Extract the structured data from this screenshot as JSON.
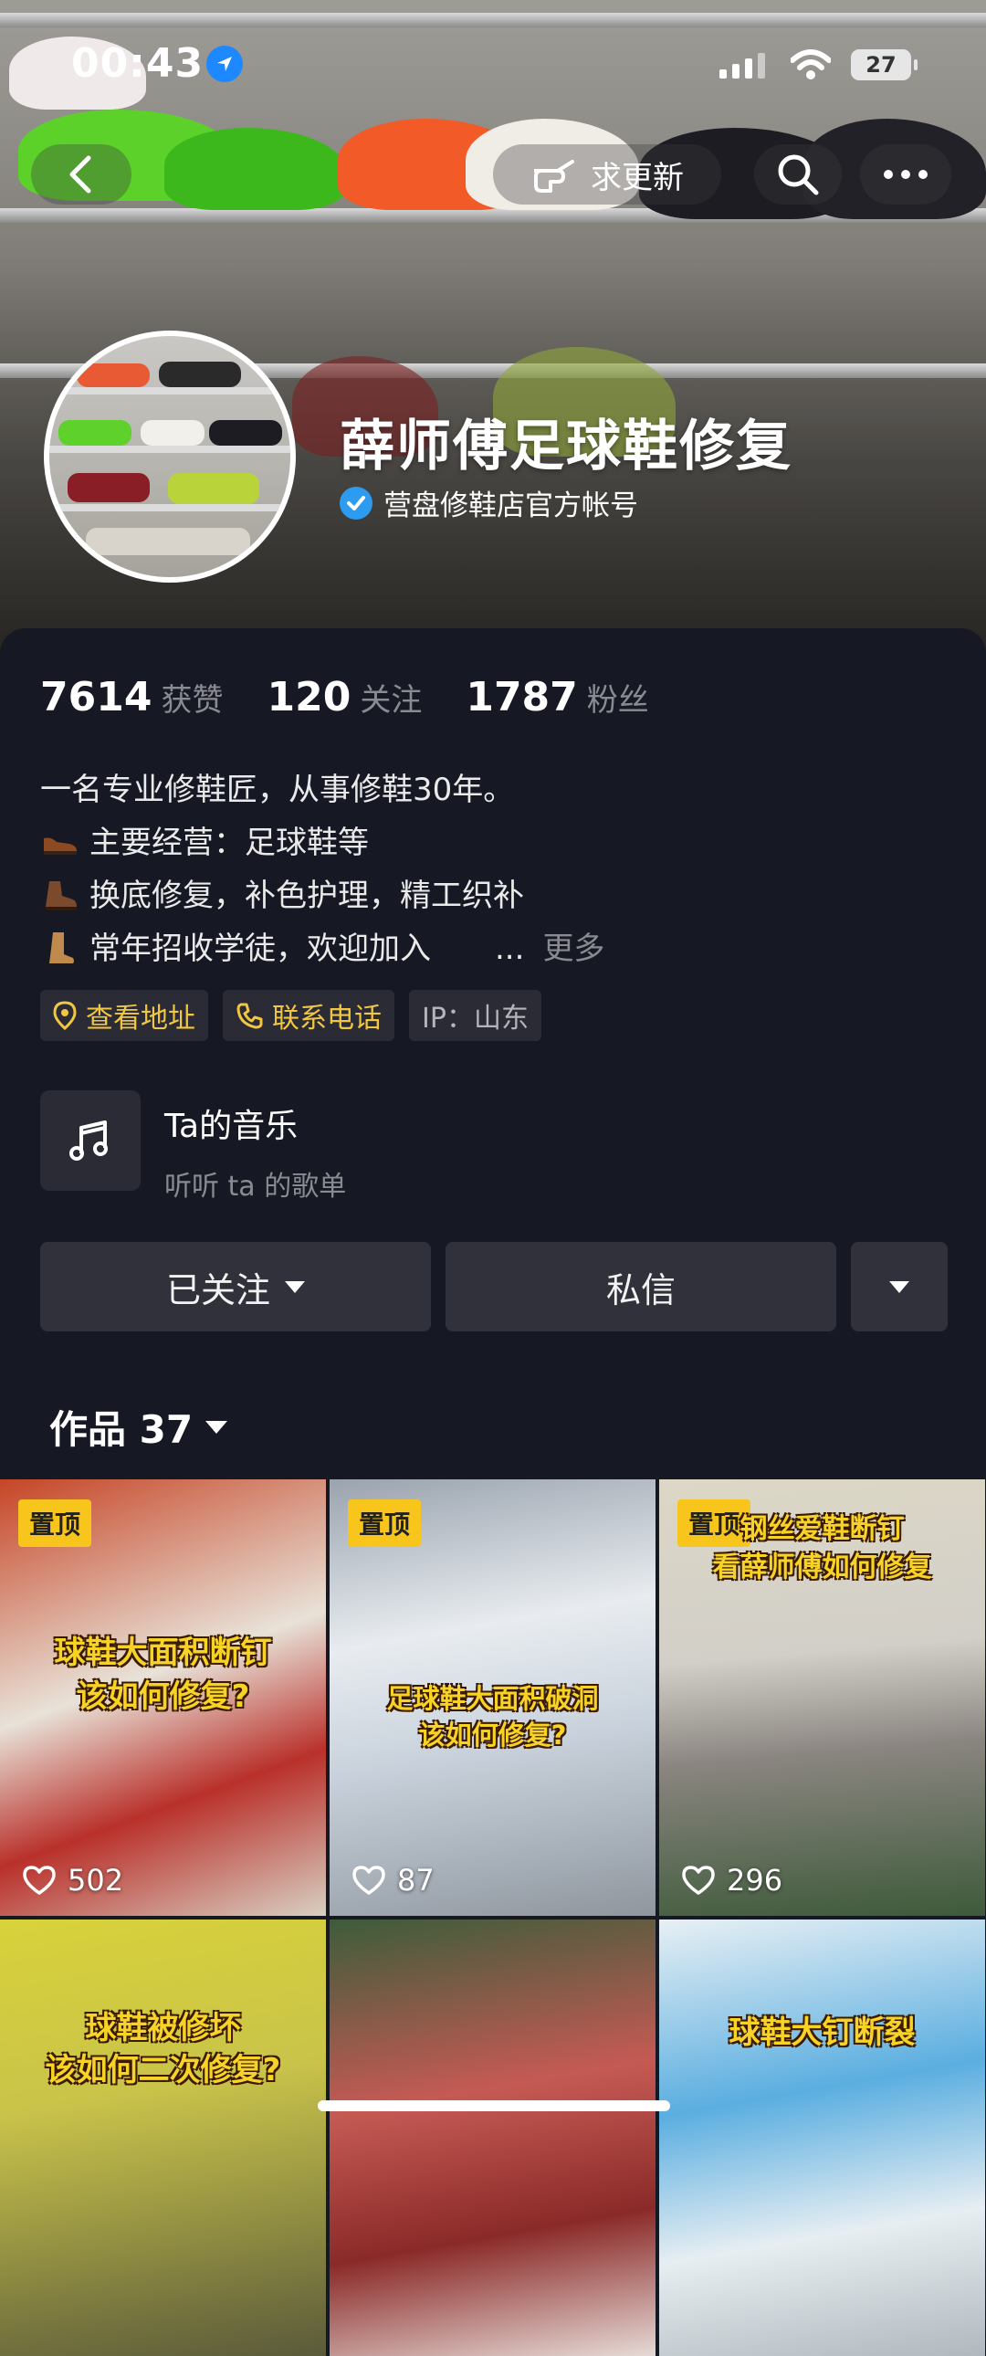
{
  "status_bar": {
    "time": "00:43",
    "battery": "27"
  },
  "top_bar": {
    "update_label": "求更新"
  },
  "profile": {
    "name": "薛师傅足球鞋修复",
    "verified_text": "营盘修鞋店官方帐号"
  },
  "stats": [
    {
      "num": "7614",
      "label": "获赞"
    },
    {
      "num": "120",
      "label": "关注"
    },
    {
      "num": "1787",
      "label": "粉丝"
    }
  ],
  "bio": {
    "line1": "一名专业修鞋匠，从事修鞋30年。",
    "line2": "主要经营：足球鞋等",
    "line3": "换底修复，补色护理，精工织补",
    "line4": "常年招收学徒，欢迎加入",
    "ellipsis": "...",
    "more": "更多"
  },
  "tags": {
    "address": "查看地址",
    "phone": "联系电话",
    "ip": "IP：山东"
  },
  "music": {
    "title": "Ta的音乐",
    "subtitle": "听听 ta 的歌单"
  },
  "actions": {
    "followed": "已关注",
    "message": "私信"
  },
  "works": {
    "label": "作品 37"
  },
  "grid": [
    {
      "pin": "置顶",
      "caption": "球鞋大面积断钉\n该如何修复?",
      "likes": "502"
    },
    {
      "pin": "置顶",
      "caption": "足球鞋大面积破洞\n该如何修复?",
      "likes": "87"
    },
    {
      "pin": "置顶",
      "caption": "钢丝爱鞋断钉\n看薛师傅如何修复",
      "likes": "296"
    },
    {
      "caption": "球鞋被修坏\n该如何二次修复?"
    },
    {
      "caption": ""
    },
    {
      "caption": "球鞋大钉断裂"
    }
  ],
  "colors": {
    "background": "#161823",
    "accent_gold": "#f1c640",
    "pin_yellow": "#f7c51c"
  }
}
